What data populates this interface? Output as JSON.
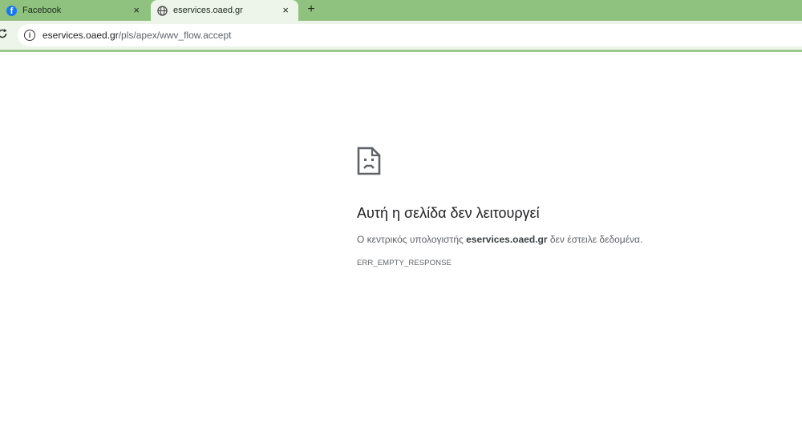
{
  "browser": {
    "tabs": [
      {
        "title": "Facebook",
        "icon": "facebook-icon",
        "active": false
      },
      {
        "title": "eservices.oaed.gr",
        "icon": "globe-icon",
        "active": true
      }
    ],
    "tab_close_glyph": "×",
    "new_tab_glyph": "+",
    "address_bar": {
      "host": "eservices.oaed.gr",
      "path": "/pls/apex/wwv_flow.accept"
    }
  },
  "error_page": {
    "icon": "sad-page-icon",
    "title": "Αυτή η σελίδα δεν λειτουργεί",
    "description_prefix": "Ο κεντρικός υπολογιστής ",
    "description_host": "eservices.oaed.gr",
    "description_suffix": " δεν έστειλε δεδομένα.",
    "error_code": "ERR_EMPTY_RESPONSE"
  },
  "colors": {
    "tab_strip": "#8fc27f",
    "toolbar": "#edf5ea",
    "facebook_blue": "#1877f2"
  }
}
